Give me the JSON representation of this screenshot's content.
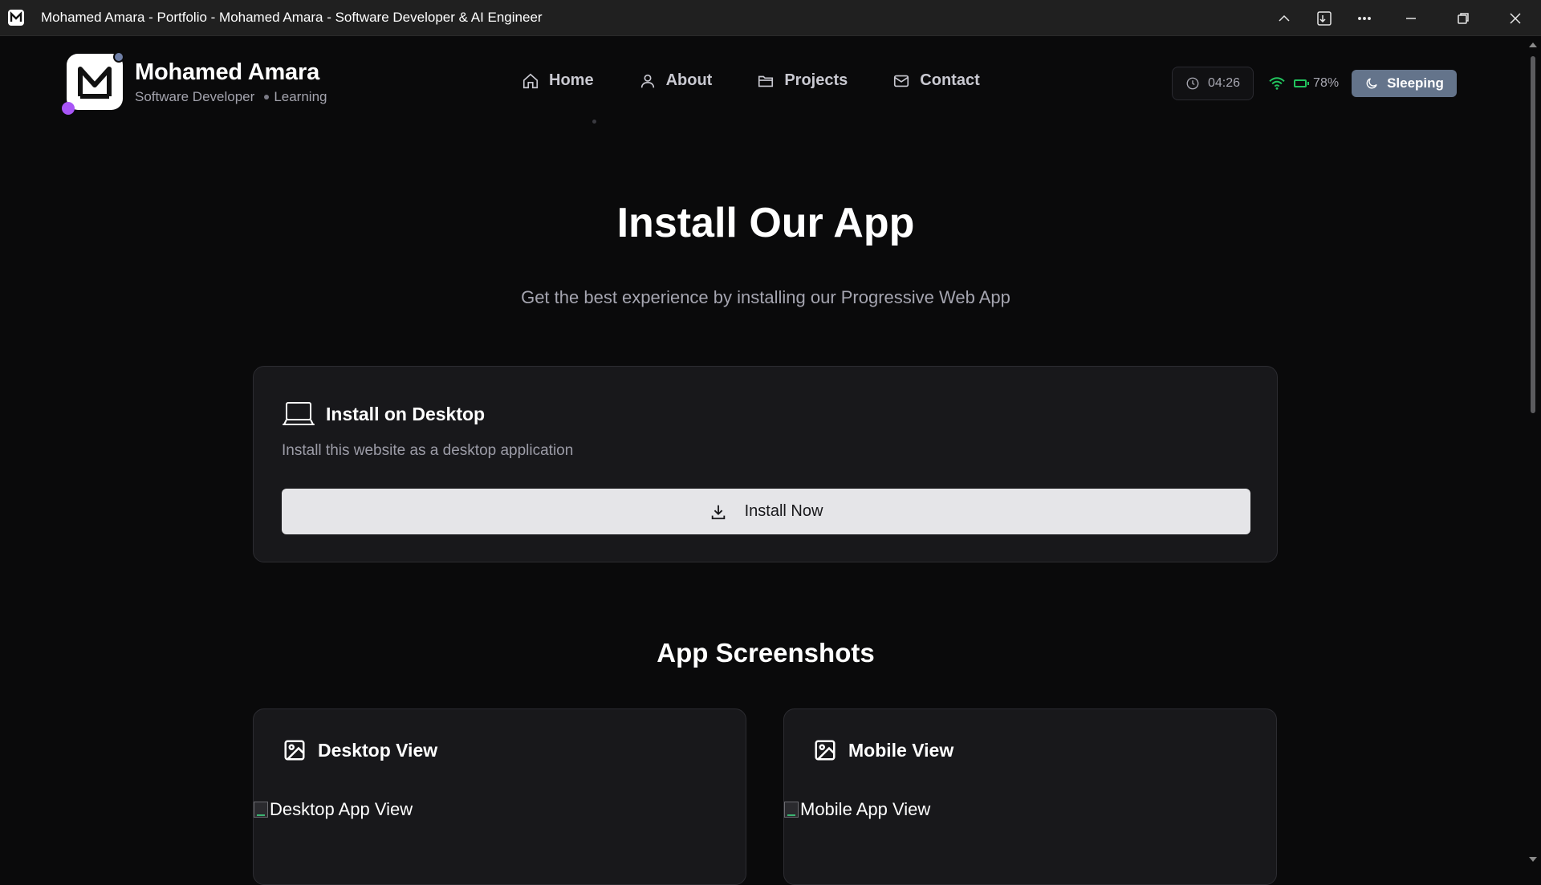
{
  "window": {
    "title": "Mohamed Amara - Portfolio - Mohamed Amara - Software Developer & AI Engineer",
    "app_icon": "m-logo-icon",
    "controls": [
      "chevron-up-icon",
      "install-app-icon",
      "more-icon",
      "minimize-icon",
      "restore-icon",
      "close-icon"
    ]
  },
  "header": {
    "brand_name": "Mohamed Amara",
    "brand_role": "Software Developer",
    "brand_status": "Learning",
    "nav": [
      {
        "label": "Home",
        "icon": "home-icon"
      },
      {
        "label": "About",
        "icon": "user-icon"
      },
      {
        "label": "Projects",
        "icon": "folder-icon"
      },
      {
        "label": "Contact",
        "icon": "mail-icon"
      }
    ],
    "clock": "04:26",
    "battery": "78%",
    "sleep_label": "Sleeping"
  },
  "main": {
    "title": "Install Our App",
    "subtitle": "Get the best experience by installing our Progressive Web App",
    "install_card": {
      "title": "Install on Desktop",
      "description": "Install this website as a desktop application",
      "button_label": "Install Now"
    },
    "screenshots": {
      "title": "App Screenshots",
      "items": [
        {
          "title": "Desktop View",
          "alt": "Desktop App View"
        },
        {
          "title": "Mobile View",
          "alt": "Mobile App View"
        }
      ]
    }
  },
  "colors": {
    "background": "#0a0a0b",
    "card": "#18181b",
    "accent_purple": "#a855f7",
    "sleep_button": "#64748b",
    "battery_green": "#22c55e"
  }
}
